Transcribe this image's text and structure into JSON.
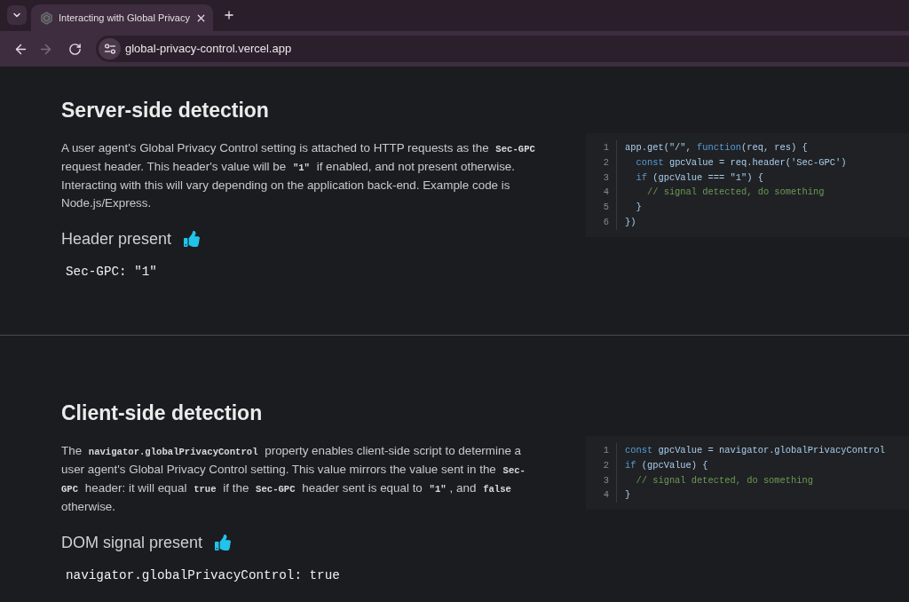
{
  "browser": {
    "tabs": [
      {
        "title": "Interacting with Global Privacy",
        "selected": true
      }
    ],
    "navigation": {
      "back": {
        "disabled": false
      },
      "forward": {
        "disabled": true
      }
    },
    "address": "global-privacy-control.vercel.app"
  },
  "sections": [
    {
      "title": "Server-side detection",
      "paragraph": [
        {
          "kind": "text",
          "text": "A user agent's Global Privacy Control setting is attached to HTTP requests as the "
        },
        {
          "kind": "code",
          "text": "Sec-GPC"
        },
        {
          "kind": "text",
          "text": " request header. This header's value will be "
        },
        {
          "kind": "code",
          "text": "\"1\""
        },
        {
          "kind": "text",
          "text": " if enabled, and not present otherwise. Interacting with this will vary depending on the application back-end. Example code is Node.js/Express."
        }
      ],
      "status": {
        "label": "Header present",
        "detected": true
      },
      "result": "Sec-GPC: \"1\"",
      "code": [
        {
          "number": "1",
          "tokens": [
            {
              "kind": "text",
              "text": "app.get(\"/\", "
            },
            {
              "kind": "keyword",
              "text": "function"
            },
            {
              "kind": "text",
              "text": "(req, res) {"
            }
          ]
        },
        {
          "number": "2",
          "tokens": [
            {
              "kind": "keyword",
              "text": "  const"
            },
            {
              "kind": "text",
              "text": " gpcValue = req.header('Sec-GPC')"
            }
          ]
        },
        {
          "number": "3",
          "tokens": [
            {
              "kind": "keyword",
              "text": "  if"
            },
            {
              "kind": "text",
              "text": " (gpcValue === \"1\") {"
            }
          ]
        },
        {
          "number": "4",
          "tokens": [
            {
              "kind": "comment",
              "text": "    // signal detected, do something"
            }
          ]
        },
        {
          "number": "5",
          "tokens": [
            {
              "kind": "text",
              "text": "  }"
            }
          ]
        },
        {
          "number": "6",
          "tokens": [
            {
              "kind": "text",
              "text": "})"
            }
          ]
        }
      ]
    },
    {
      "title": "Client-side detection",
      "paragraph": [
        {
          "kind": "text",
          "text": "The "
        },
        {
          "kind": "code",
          "text": "navigator.globalPrivacyControl"
        },
        {
          "kind": "text",
          "text": " property enables client-side script to determine a user agent's Global Privacy Control setting. This value mirrors the value sent in the "
        },
        {
          "kind": "code",
          "text": "Sec-GPC"
        },
        {
          "kind": "text",
          "text": " header: it will equal "
        },
        {
          "kind": "code",
          "text": "true"
        },
        {
          "kind": "text",
          "text": " if the "
        },
        {
          "kind": "code",
          "text": "Sec-GPC"
        },
        {
          "kind": "text",
          "text": " header sent is equal to "
        },
        {
          "kind": "code",
          "text": "\"1\""
        },
        {
          "kind": "text",
          "text": ", and "
        },
        {
          "kind": "code",
          "text": "false"
        },
        {
          "kind": "text",
          "text": " otherwise."
        }
      ],
      "status": {
        "label": "DOM signal present",
        "detected": true
      },
      "result": "navigator.globalPrivacyControl: true",
      "code": [
        {
          "number": "1",
          "tokens": [
            {
              "kind": "keyword",
              "text": "const"
            },
            {
              "kind": "text",
              "text": " gpcValue = navigator.globalPrivacyControl"
            }
          ]
        },
        {
          "number": "2",
          "tokens": [
            {
              "kind": "keyword",
              "text": "if"
            },
            {
              "kind": "text",
              "text": " (gpcValue) {"
            }
          ]
        },
        {
          "number": "3",
          "tokens": [
            {
              "kind": "comment",
              "text": "  // signal detected, do something"
            }
          ]
        },
        {
          "number": "4",
          "tokens": [
            {
              "kind": "text",
              "text": "}"
            }
          ]
        }
      ]
    }
  ]
}
